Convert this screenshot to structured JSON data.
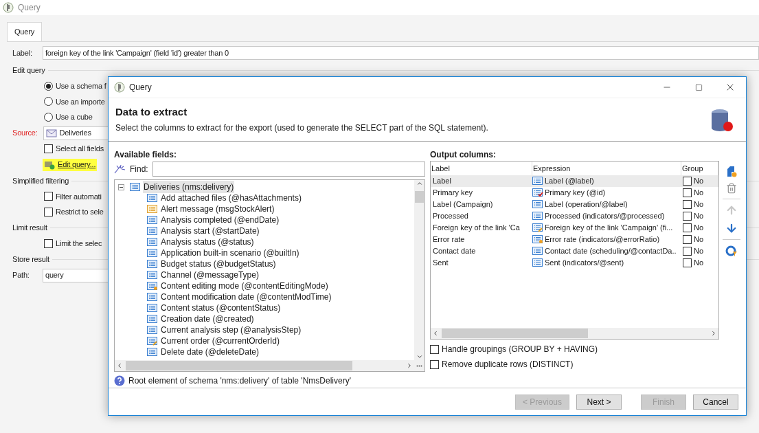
{
  "window": {
    "title": "Query"
  },
  "tabs": [
    {
      "label": "Query",
      "selected": true
    }
  ],
  "form": {
    "label_caption": "Label:",
    "label_value": "foreign key of the link 'Campaign' (field 'id') greater than 0",
    "edit_query_heading": "Edit query",
    "options": [
      {
        "label": "Use a schema f",
        "selected": true
      },
      {
        "label": "Use an importe",
        "selected": false
      },
      {
        "label": "Use a cube",
        "selected": false
      }
    ],
    "source_caption": "Source:",
    "source_value": "Deliveries",
    "select_all": {
      "label": "Select all fields",
      "checked": false
    },
    "edit_query_link": "Edit query...",
    "simplified_heading": "Simplified filtering",
    "filter_options": [
      {
        "label": "Filter automati",
        "checked": false
      },
      {
        "label": "Restrict to sele",
        "checked": false
      }
    ],
    "limit_heading": "Limit result",
    "limit_option": {
      "label": "Limit the selec",
      "checked": false
    },
    "store_heading": "Store result",
    "path_caption": "Path:",
    "path_value": "query"
  },
  "dialog": {
    "title": "Query",
    "heading": "Data to extract",
    "subtitle": "Select the columns to extract for the export (used to generate the SELECT part of the SQL statement).",
    "available_label": "Available fields:",
    "find_label": "Find:",
    "tree": [
      {
        "label": "Deliveries (nms:delivery)",
        "kind": "table",
        "selected": true,
        "expanded": true,
        "children": [
          {
            "label": "Add attached files (@hasAttachments)",
            "kind": "field",
            "selected": false
          },
          {
            "label": "Alert message (msgStockAlert)",
            "kind": "link",
            "selected": false
          },
          {
            "label": "Analysis completed (@endDate)",
            "kind": "field",
            "selected": false
          },
          {
            "label": "Analysis start (@startDate)",
            "kind": "field",
            "selected": false
          },
          {
            "label": "Analysis status (@status)",
            "kind": "field",
            "selected": false
          },
          {
            "label": "Application built-in scenario (@builtIn)",
            "kind": "field",
            "selected": false
          },
          {
            "label": "Budget status (@budgetStatus)",
            "kind": "field",
            "selected": false
          },
          {
            "label": "Channel (@messageType)",
            "kind": "field",
            "selected": false
          },
          {
            "label": "Content editing mode (@contentEditingMode)",
            "kind": "computed",
            "selected": false
          },
          {
            "label": "Content modification date (@contentModTime)",
            "kind": "field",
            "selected": false
          },
          {
            "label": "Content status (@contentStatus)",
            "kind": "field",
            "selected": false
          },
          {
            "label": "Creation date (@created)",
            "kind": "field",
            "selected": false
          },
          {
            "label": "Current analysis step (@analysisStep)",
            "kind": "field",
            "selected": false
          },
          {
            "label": "Current order (@currentOrderId)",
            "kind": "foreign-key",
            "selected": false
          },
          {
            "label": "Delete date (@deleteDate)",
            "kind": "field",
            "selected": false
          }
        ]
      }
    ],
    "info": "Root element of schema 'nms:delivery' of table 'NmsDelivery'",
    "output_label": "Output columns:",
    "columns": [
      "Label",
      "Expression",
      "Group"
    ],
    "rows": [
      {
        "label": "Label",
        "expression": "Label (@label)",
        "kind": "field",
        "group": "No",
        "checked": false,
        "selected": true
      },
      {
        "label": "Primary key",
        "expression": "Primary key (@id)",
        "kind": "primary-key",
        "group": "No",
        "checked": false,
        "selected": false
      },
      {
        "label": "Label (Campaign)",
        "expression": "Label (operation/@label)",
        "kind": "field",
        "group": "No",
        "checked": false,
        "selected": false
      },
      {
        "label": "Processed",
        "expression": "Processed (indicators/@processed)",
        "kind": "field",
        "group": "No",
        "checked": false,
        "selected": false
      },
      {
        "label": "Foreign key of the link 'Ca",
        "expression": "Foreign key of the link 'Campaign' (fi...",
        "kind": "foreign-key",
        "group": "No",
        "checked": false,
        "selected": false
      },
      {
        "label": "Error rate",
        "expression": "Error rate (indicators/@errorRatio)",
        "kind": "computed",
        "group": "No",
        "checked": false,
        "selected": false
      },
      {
        "label": "Contact date",
        "expression": "Contact date (scheduling/@contactDa..",
        "kind": "field",
        "group": "No",
        "checked": false,
        "selected": false
      },
      {
        "label": "Sent",
        "expression": "Sent (indicators/@sent)",
        "kind": "field",
        "group": "No",
        "checked": false,
        "selected": false
      }
    ],
    "options": [
      {
        "label": "Handle groupings (GROUP BY + HAVING)",
        "checked": false
      },
      {
        "label": "Remove duplicate rows (DISTINCT)",
        "checked": false
      }
    ],
    "buttons": [
      {
        "label": "< Previous",
        "disabled": true
      },
      {
        "label": "Next >",
        "disabled": false
      },
      {
        "label": "Finish",
        "disabled": true
      },
      {
        "label": "Cancel",
        "disabled": false
      }
    ]
  }
}
